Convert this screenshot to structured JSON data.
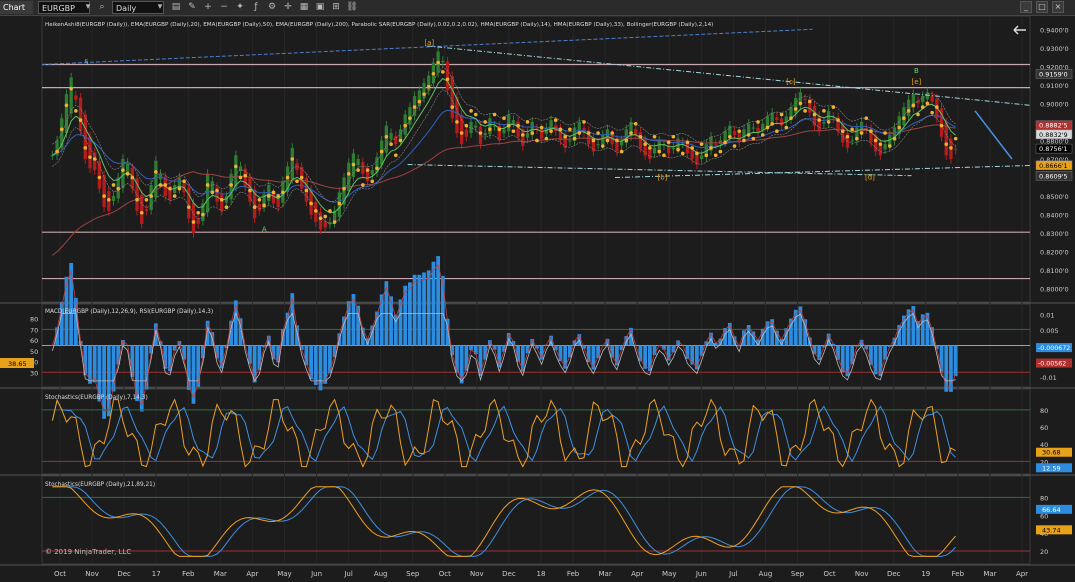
{
  "toolbar": {
    "tab_label": "Chart",
    "instrument": "EURGBP",
    "timeframe": "Daily",
    "icons": [
      "dropdown-icon",
      "search-icon",
      "bar-type-icon",
      "drawing-tools-icon",
      "zoom-in-icon",
      "zoom-out-icon",
      "strategies-icon",
      "indicators-icon",
      "properties-icon",
      "crosshair-icon",
      "templates-icon",
      "data-box-icon",
      "tile-icon",
      "link-icon"
    ],
    "window_buttons": [
      "minimize",
      "maximize",
      "close"
    ]
  },
  "colors": {
    "background": "#1c1c1c",
    "price_up": "#2e7d32",
    "price_down": "#b71c1c",
    "sar": "#f0b030",
    "macd_hist": "#2c8de0",
    "stoch_k": "#f0a020",
    "stoch_d": "#3f8fe0",
    "axis_text": "#cccccc"
  },
  "chart_data": {
    "type": "line",
    "x_labels": [
      "Oct",
      "Nov",
      "Dec",
      "17",
      "Feb",
      "Mar",
      "Apr",
      "May",
      "Jun",
      "Jul",
      "Aug",
      "Sep",
      "Oct",
      "Nov",
      "Dec",
      "18",
      "Feb",
      "Mar",
      "Apr",
      "May",
      "Jun",
      "Jul",
      "Aug",
      "Sep",
      "Oct",
      "Nov",
      "Dec",
      "19",
      "Feb",
      "Mar",
      "Apr"
    ],
    "copyright": "© 2019 NinjaTrader, LLC",
    "panels": [
      {
        "name": "price",
        "indicators_label": "HeikenAshi8(EURGBP (Daily)), EMA(EURGBP (Daily),20), EMA(EURGBP (Daily),50), EMA(EURGBP (Daily),200), Parabolic SAR(EURGBP (Daily),0.02,0.2,0.02), HMA(EURGBP (Daily),14), HMA(EURGBP (Daily),33), Bollinger(EURGBP (Daily),2,14)",
        "y_ticks": [
          "0.9400'0",
          "0.9300'0",
          "0.9200'0",
          "0.9100'0",
          "0.9000'0",
          "0.8900'0",
          "0.8800'0",
          "0.8700'0",
          "0.8600'0",
          "0.8500'0",
          "0.8400'0",
          "0.8300'0",
          "0.8200'0",
          "0.8100'0",
          "0.8000'0"
        ],
        "ylim": [
          0.795,
          0.945
        ],
        "price_tags": [
          {
            "label": "0.9159'0",
            "value": 0.9159,
            "color": "#333333"
          },
          {
            "label": "0.8882'5",
            "value": 0.88825,
            "color": "#b03030"
          },
          {
            "label": "0.8832'9",
            "value": 0.88329,
            "color": "#d9d9d9"
          },
          {
            "label": "0.8756'1",
            "value": 0.87561,
            "color": "#000000"
          },
          {
            "label": "0.8666'1",
            "value": 0.86661,
            "color": "#e8a21a"
          },
          {
            "label": "0.8609'5",
            "value": 0.86095,
            "color": "#333333"
          }
        ],
        "wave_labels": [
          {
            "text": "5",
            "x": 0.045,
            "y": 0.921
          },
          {
            "text": "A",
            "x": 0.225,
            "y": 0.8308
          },
          {
            "text": "[a]",
            "x": 0.392,
            "y": 0.9315
          },
          {
            "text": "[b]",
            "x": 0.628,
            "y": 0.859
          },
          {
            "text": "[c]",
            "x": 0.758,
            "y": 0.9105
          },
          {
            "text": "[d]",
            "x": 0.838,
            "y": 0.859
          },
          {
            "text": "B",
            "x": 0.885,
            "y": 0.9165
          },
          {
            "text": "[e]",
            "x": 0.885,
            "y": 0.9105
          }
        ],
        "horizontal_levels": [
          0.921,
          0.9085,
          0.8305,
          0.8055
        ],
        "ohlc_closes": [
          0.872,
          0.88,
          0.892,
          0.905,
          0.914,
          0.902,
          0.885,
          0.87,
          0.865,
          0.864,
          0.854,
          0.844,
          0.842,
          0.85,
          0.86,
          0.87,
          0.868,
          0.854,
          0.842,
          0.835,
          0.842,
          0.856,
          0.869,
          0.862,
          0.85,
          0.848,
          0.856,
          0.86,
          0.852,
          0.838,
          0.83,
          0.835,
          0.846,
          0.862,
          0.858,
          0.847,
          0.842,
          0.85,
          0.862,
          0.872,
          0.866,
          0.855,
          0.847,
          0.838,
          0.842,
          0.851,
          0.856,
          0.846,
          0.844,
          0.858,
          0.866,
          0.876,
          0.864,
          0.854,
          0.847,
          0.84,
          0.836,
          0.832,
          0.833,
          0.836,
          0.842,
          0.852,
          0.86,
          0.868,
          0.873,
          0.87,
          0.862,
          0.858,
          0.864,
          0.871,
          0.88,
          0.888,
          0.884,
          0.878,
          0.886,
          0.894,
          0.898,
          0.904,
          0.907,
          0.911,
          0.915,
          0.922,
          0.928,
          0.923,
          0.907,
          0.892,
          0.884,
          0.878,
          0.882,
          0.89,
          0.888,
          0.878,
          0.884,
          0.892,
          0.888,
          0.88,
          0.886,
          0.894,
          0.891,
          0.882,
          0.877,
          0.884,
          0.89,
          0.886,
          0.881,
          0.887,
          0.891,
          0.885,
          0.88,
          0.876,
          0.88,
          0.887,
          0.89,
          0.884,
          0.878,
          0.874,
          0.878,
          0.883,
          0.886,
          0.878,
          0.874,
          0.88,
          0.886,
          0.89,
          0.883,
          0.876,
          0.872,
          0.87,
          0.876,
          0.88,
          0.878,
          0.873,
          0.876,
          0.881,
          0.879,
          0.873,
          0.87,
          0.867,
          0.872,
          0.878,
          0.882,
          0.878,
          0.88,
          0.885,
          0.888,
          0.883,
          0.879,
          0.886,
          0.889,
          0.887,
          0.884,
          0.889,
          0.893,
          0.895,
          0.891,
          0.888,
          0.893,
          0.898,
          0.903,
          0.906,
          0.902,
          0.895,
          0.888,
          0.885,
          0.89,
          0.896,
          0.892,
          0.885,
          0.879,
          0.876,
          0.88,
          0.887,
          0.89,
          0.886,
          0.879,
          0.874,
          0.872,
          0.878,
          0.883,
          0.887,
          0.893,
          0.898,
          0.902,
          0.905,
          0.9,
          0.904,
          0.906,
          0.901,
          0.892,
          0.882,
          0.872,
          0.87,
          0.875
        ]
      },
      {
        "name": "macd_rsi",
        "indicators_label": "MACD(EURGBP (Daily),12,26,9), RSI(EURGBP (Daily),14,3)",
        "left_ticks": [
          "80",
          "70",
          "60",
          "50",
          "40",
          "30"
        ],
        "right_ticks": [
          "0.01",
          "0.005",
          "0",
          "-0.005",
          "-0.01"
        ],
        "left_tag": "38.65",
        "right_tags": [
          {
            "label": "-0.000672",
            "color": "#2c8de0"
          },
          {
            "label": "-0.00562",
            "color": "#b03030"
          }
        ]
      },
      {
        "name": "stoch_fast",
        "indicators_label": "Stochastics(EURGBP (Daily),7,14,3)",
        "right_ticks": [
          "80",
          "60",
          "40",
          "20"
        ],
        "right_tags": [
          {
            "label": "30.68",
            "color": "#e8a21a"
          },
          {
            "label": "12.59",
            "color": "#2c8de0"
          }
        ]
      },
      {
        "name": "stoch_slow",
        "indicators_label": "Stochastics(EURGBP (Daily),21,89,21)",
        "right_ticks": [
          "80",
          "60",
          "40",
          "20"
        ],
        "right_tags": [
          {
            "label": "66.64",
            "color": "#2c8de0"
          },
          {
            "label": "43.74",
            "color": "#e8a21a"
          }
        ]
      }
    ]
  }
}
